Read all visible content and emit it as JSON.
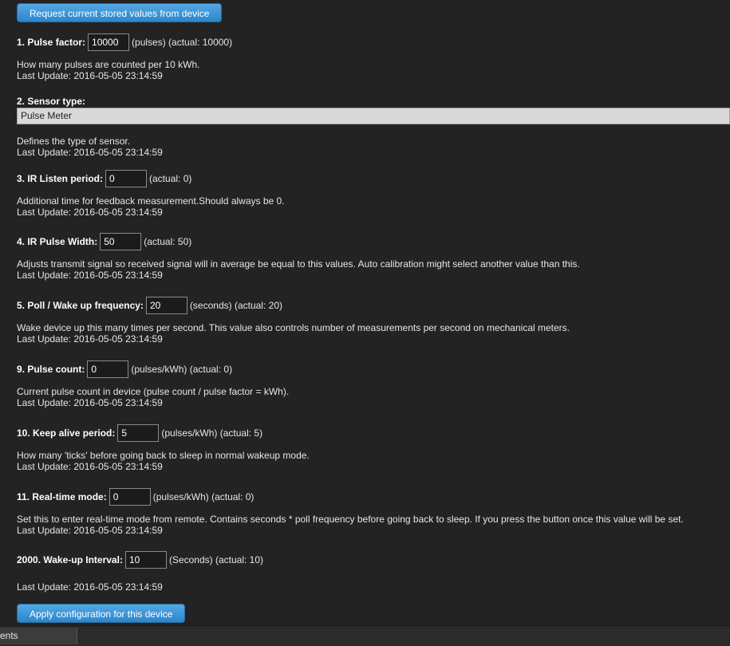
{
  "buttons": {
    "request": "Request current stored values from device",
    "apply": "Apply configuration for this device"
  },
  "params": {
    "p1": {
      "label": "1. Pulse factor:",
      "value": "10000",
      "suffix": "(pulses) (actual: 10000)",
      "desc": "How many pulses are counted per 10 kWh.",
      "update": "Last Update: 2016-05-05 23:14:59"
    },
    "p2": {
      "label": "2. Sensor type:",
      "selected": "Pulse Meter",
      "desc": "Defines the type of sensor.",
      "update": "Last Update: 2016-05-05 23:14:59"
    },
    "p3": {
      "label": "3. IR Listen period:",
      "value": "0",
      "suffix": "(actual: 0)",
      "desc": "Additional time for feedback measurement.Should always be 0.",
      "update": "Last Update: 2016-05-05 23:14:59"
    },
    "p4": {
      "label": "4. IR Pulse Width:",
      "value": "50",
      "suffix": "(actual: 50)",
      "desc": "Adjusts transmit signal so received signal will in average be equal to this values. Auto calibration might select another value than this.",
      "update": "Last Update: 2016-05-05 23:14:59"
    },
    "p5": {
      "label": "5. Poll / Wake up frequency:",
      "value": "20",
      "suffix": "(seconds) (actual: 20)",
      "desc": "Wake device up this many times per second. This value also controls number of measurements per second on mechanical meters.",
      "update": "Last Update: 2016-05-05 23:14:59"
    },
    "p9": {
      "label": "9. Pulse count:",
      "value": "0",
      "suffix": "(pulses/kWh) (actual: 0)",
      "desc": "Current pulse count in device (pulse count / pulse factor = kWh).",
      "update": "Last Update: 2016-05-05 23:14:59"
    },
    "p10": {
      "label": "10. Keep alive period:",
      "value": "5",
      "suffix": "(pulses/kWh) (actual: 5)",
      "desc": "How many 'ticks' before going back to sleep in normal wakeup mode.",
      "update": "Last Update: 2016-05-05 23:14:59"
    },
    "p11": {
      "label": "11. Real-time mode:",
      "value": "0",
      "suffix": "(pulses/kWh) (actual: 0)",
      "desc": "Set this to enter real-time mode from remote. Contains seconds * poll frequency before going back to sleep. If you press the button once this value will be set.",
      "update": "Last Update: 2016-05-05 23:14:59"
    },
    "p2000": {
      "label": "2000. Wake-up Interval:",
      "value": "10",
      "suffix": "(Seconds) (actual: 10)",
      "update": "Last Update: 2016-05-05 23:14:59"
    }
  },
  "bottom": {
    "tab_label": "ents"
  },
  "colors": {
    "background": "#232323",
    "button": "#3b95d6",
    "select": "#d9d9d9"
  }
}
